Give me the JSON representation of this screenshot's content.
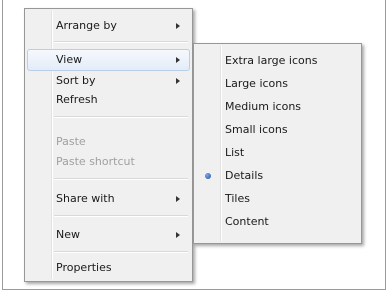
{
  "context_menu": {
    "items": [
      {
        "label": "Arrange by",
        "submenu": true
      },
      {
        "label": "View",
        "submenu": true,
        "highlighted": true
      },
      {
        "label": "Sort by",
        "submenu": true
      },
      {
        "label": "Refresh"
      },
      {
        "label": "Paste",
        "disabled": true
      },
      {
        "label": "Paste shortcut",
        "disabled": true
      },
      {
        "label": "Share with",
        "submenu": true
      },
      {
        "label": "New",
        "submenu": true
      },
      {
        "label": "Properties"
      }
    ]
  },
  "view_submenu": {
    "items": [
      {
        "label": "Extra large icons"
      },
      {
        "label": "Large icons"
      },
      {
        "label": "Medium icons"
      },
      {
        "label": "Small icons"
      },
      {
        "label": "List"
      },
      {
        "label": "Details",
        "selected": true,
        "indicator": "radio-dot-icon"
      },
      {
        "label": "Tiles"
      },
      {
        "label": "Content"
      }
    ]
  },
  "colors": {
    "menu_background": "#f0f0f0",
    "highlight_border": "#b9cfe8",
    "disabled_text": "#a0a0a0",
    "radio_dot": "#1e4fa8"
  }
}
